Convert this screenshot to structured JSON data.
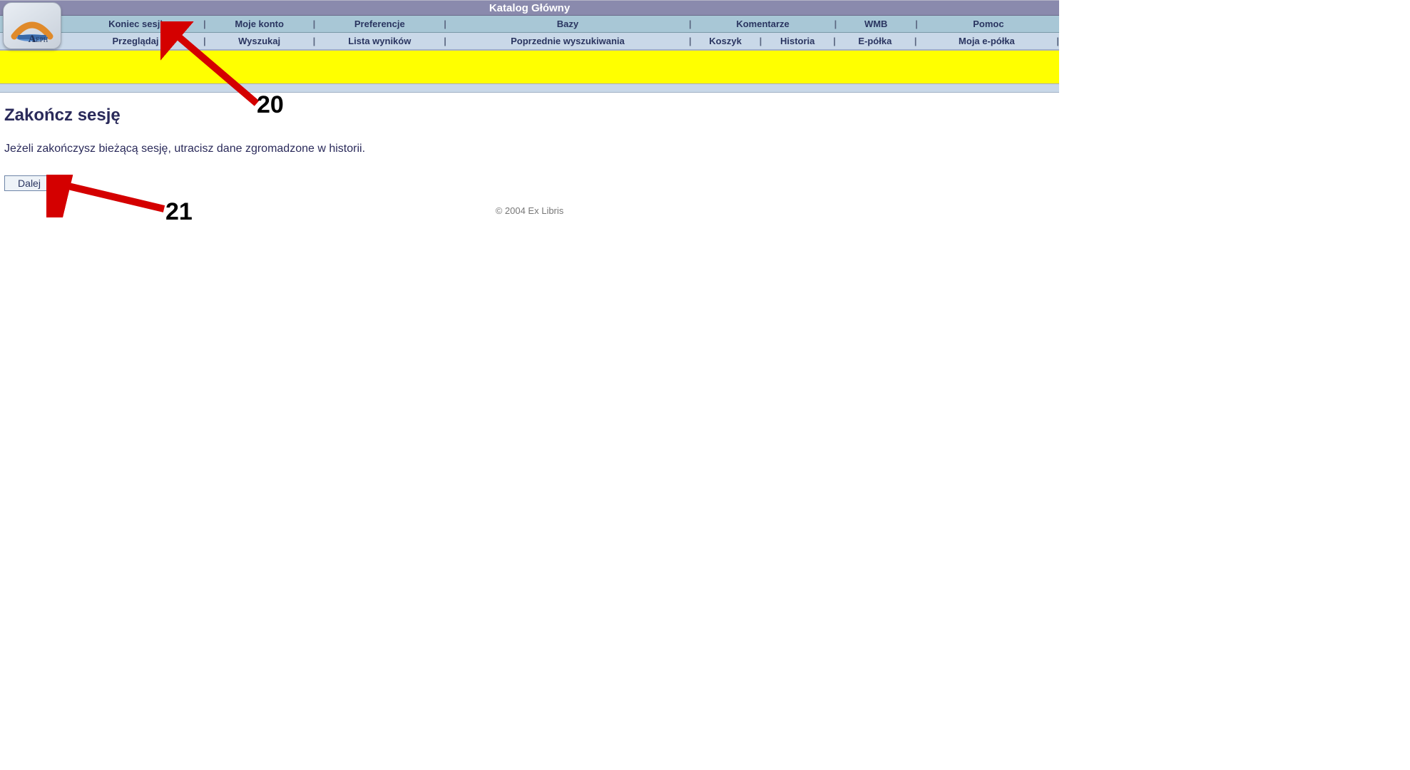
{
  "header": {
    "title": "Katalog Główny",
    "logo_text": "ALEPH"
  },
  "nav_top": {
    "items": [
      {
        "label": "Koniec sesji"
      },
      {
        "label": "Moje konto"
      },
      {
        "label": "Preferencje"
      },
      {
        "label": "Bazy"
      },
      {
        "label": "Komentarze"
      },
      {
        "label": "WMB"
      },
      {
        "label": "Pomoc"
      }
    ]
  },
  "nav_bot": {
    "items": [
      {
        "label": "Przeglądaj"
      },
      {
        "label": "Wyszukaj"
      },
      {
        "label": "Lista wyników"
      },
      {
        "label": "Poprzednie wyszukiwania"
      },
      {
        "label": "Koszyk"
      },
      {
        "label": "Historia"
      },
      {
        "label": "E-półka"
      },
      {
        "label": "Moja e-półka"
      }
    ]
  },
  "main": {
    "heading": "Zakończ sesję",
    "message": "Jeżeli zakończysz bieżącą sesję, utracisz dane zgromadzone w historii.",
    "continue_button": "Dalej"
  },
  "footer": {
    "copyright": "© 2004 Ex Libris"
  },
  "annotations": {
    "a20": "20",
    "a21": "21"
  }
}
